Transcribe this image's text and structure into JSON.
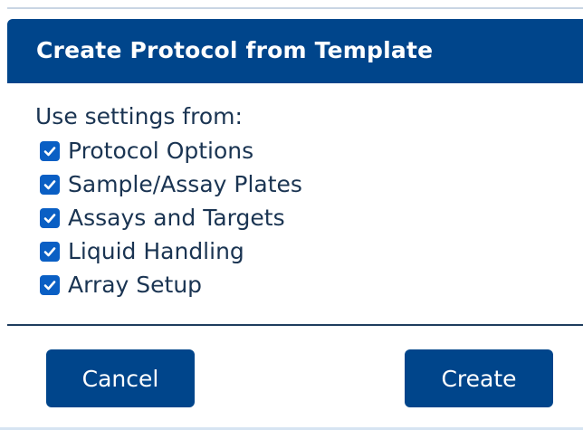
{
  "dialog": {
    "title": "Create Protocol from Template",
    "section_label": "Use settings from:",
    "options": [
      {
        "label": "Protocol Options",
        "checked": true
      },
      {
        "label": "Sample/Assay Plates",
        "checked": true
      },
      {
        "label": "Assays and Targets",
        "checked": true
      },
      {
        "label": "Liquid Handling",
        "checked": true
      },
      {
        "label": "Array Setup",
        "checked": true
      }
    ],
    "buttons": {
      "cancel_label": "Cancel",
      "create_label": "Create"
    }
  },
  "colors": {
    "header_bg": "#00458b",
    "button_bg": "#00458b",
    "checkbox_bg": "#0a5fc4",
    "text": "#1a3452"
  },
  "icons": {
    "checkbox": "check-icon"
  }
}
